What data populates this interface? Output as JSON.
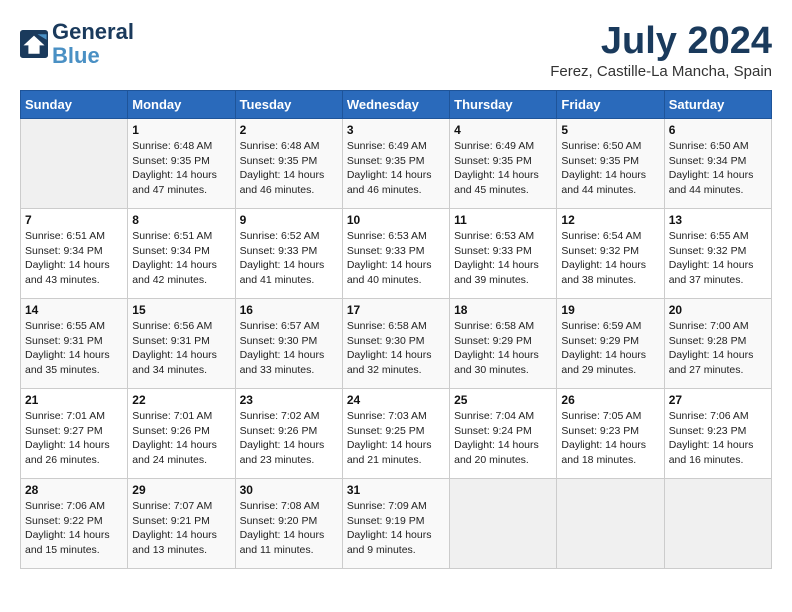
{
  "header": {
    "logo_line1": "General",
    "logo_line2": "Blue",
    "month_year": "July 2024",
    "location": "Ferez, Castille-La Mancha, Spain"
  },
  "weekdays": [
    "Sunday",
    "Monday",
    "Tuesday",
    "Wednesday",
    "Thursday",
    "Friday",
    "Saturday"
  ],
  "weeks": [
    [
      {
        "day": "",
        "content": ""
      },
      {
        "day": "1",
        "content": "Sunrise: 6:48 AM\nSunset: 9:35 PM\nDaylight: 14 hours\nand 47 minutes."
      },
      {
        "day": "2",
        "content": "Sunrise: 6:48 AM\nSunset: 9:35 PM\nDaylight: 14 hours\nand 46 minutes."
      },
      {
        "day": "3",
        "content": "Sunrise: 6:49 AM\nSunset: 9:35 PM\nDaylight: 14 hours\nand 46 minutes."
      },
      {
        "day": "4",
        "content": "Sunrise: 6:49 AM\nSunset: 9:35 PM\nDaylight: 14 hours\nand 45 minutes."
      },
      {
        "day": "5",
        "content": "Sunrise: 6:50 AM\nSunset: 9:35 PM\nDaylight: 14 hours\nand 44 minutes."
      },
      {
        "day": "6",
        "content": "Sunrise: 6:50 AM\nSunset: 9:34 PM\nDaylight: 14 hours\nand 44 minutes."
      }
    ],
    [
      {
        "day": "7",
        "content": "Sunrise: 6:51 AM\nSunset: 9:34 PM\nDaylight: 14 hours\nand 43 minutes."
      },
      {
        "day": "8",
        "content": "Sunrise: 6:51 AM\nSunset: 9:34 PM\nDaylight: 14 hours\nand 42 minutes."
      },
      {
        "day": "9",
        "content": "Sunrise: 6:52 AM\nSunset: 9:33 PM\nDaylight: 14 hours\nand 41 minutes."
      },
      {
        "day": "10",
        "content": "Sunrise: 6:53 AM\nSunset: 9:33 PM\nDaylight: 14 hours\nand 40 minutes."
      },
      {
        "day": "11",
        "content": "Sunrise: 6:53 AM\nSunset: 9:33 PM\nDaylight: 14 hours\nand 39 minutes."
      },
      {
        "day": "12",
        "content": "Sunrise: 6:54 AM\nSunset: 9:32 PM\nDaylight: 14 hours\nand 38 minutes."
      },
      {
        "day": "13",
        "content": "Sunrise: 6:55 AM\nSunset: 9:32 PM\nDaylight: 14 hours\nand 37 minutes."
      }
    ],
    [
      {
        "day": "14",
        "content": "Sunrise: 6:55 AM\nSunset: 9:31 PM\nDaylight: 14 hours\nand 35 minutes."
      },
      {
        "day": "15",
        "content": "Sunrise: 6:56 AM\nSunset: 9:31 PM\nDaylight: 14 hours\nand 34 minutes."
      },
      {
        "day": "16",
        "content": "Sunrise: 6:57 AM\nSunset: 9:30 PM\nDaylight: 14 hours\nand 33 minutes."
      },
      {
        "day": "17",
        "content": "Sunrise: 6:58 AM\nSunset: 9:30 PM\nDaylight: 14 hours\nand 32 minutes."
      },
      {
        "day": "18",
        "content": "Sunrise: 6:58 AM\nSunset: 9:29 PM\nDaylight: 14 hours\nand 30 minutes."
      },
      {
        "day": "19",
        "content": "Sunrise: 6:59 AM\nSunset: 9:29 PM\nDaylight: 14 hours\nand 29 minutes."
      },
      {
        "day": "20",
        "content": "Sunrise: 7:00 AM\nSunset: 9:28 PM\nDaylight: 14 hours\nand 27 minutes."
      }
    ],
    [
      {
        "day": "21",
        "content": "Sunrise: 7:01 AM\nSunset: 9:27 PM\nDaylight: 14 hours\nand 26 minutes."
      },
      {
        "day": "22",
        "content": "Sunrise: 7:01 AM\nSunset: 9:26 PM\nDaylight: 14 hours\nand 24 minutes."
      },
      {
        "day": "23",
        "content": "Sunrise: 7:02 AM\nSunset: 9:26 PM\nDaylight: 14 hours\nand 23 minutes."
      },
      {
        "day": "24",
        "content": "Sunrise: 7:03 AM\nSunset: 9:25 PM\nDaylight: 14 hours\nand 21 minutes."
      },
      {
        "day": "25",
        "content": "Sunrise: 7:04 AM\nSunset: 9:24 PM\nDaylight: 14 hours\nand 20 minutes."
      },
      {
        "day": "26",
        "content": "Sunrise: 7:05 AM\nSunset: 9:23 PM\nDaylight: 14 hours\nand 18 minutes."
      },
      {
        "day": "27",
        "content": "Sunrise: 7:06 AM\nSunset: 9:23 PM\nDaylight: 14 hours\nand 16 minutes."
      }
    ],
    [
      {
        "day": "28",
        "content": "Sunrise: 7:06 AM\nSunset: 9:22 PM\nDaylight: 14 hours\nand 15 minutes."
      },
      {
        "day": "29",
        "content": "Sunrise: 7:07 AM\nSunset: 9:21 PM\nDaylight: 14 hours\nand 13 minutes."
      },
      {
        "day": "30",
        "content": "Sunrise: 7:08 AM\nSunset: 9:20 PM\nDaylight: 14 hours\nand 11 minutes."
      },
      {
        "day": "31",
        "content": "Sunrise: 7:09 AM\nSunset: 9:19 PM\nDaylight: 14 hours\nand 9 minutes."
      },
      {
        "day": "",
        "content": ""
      },
      {
        "day": "",
        "content": ""
      },
      {
        "day": "",
        "content": ""
      }
    ]
  ]
}
